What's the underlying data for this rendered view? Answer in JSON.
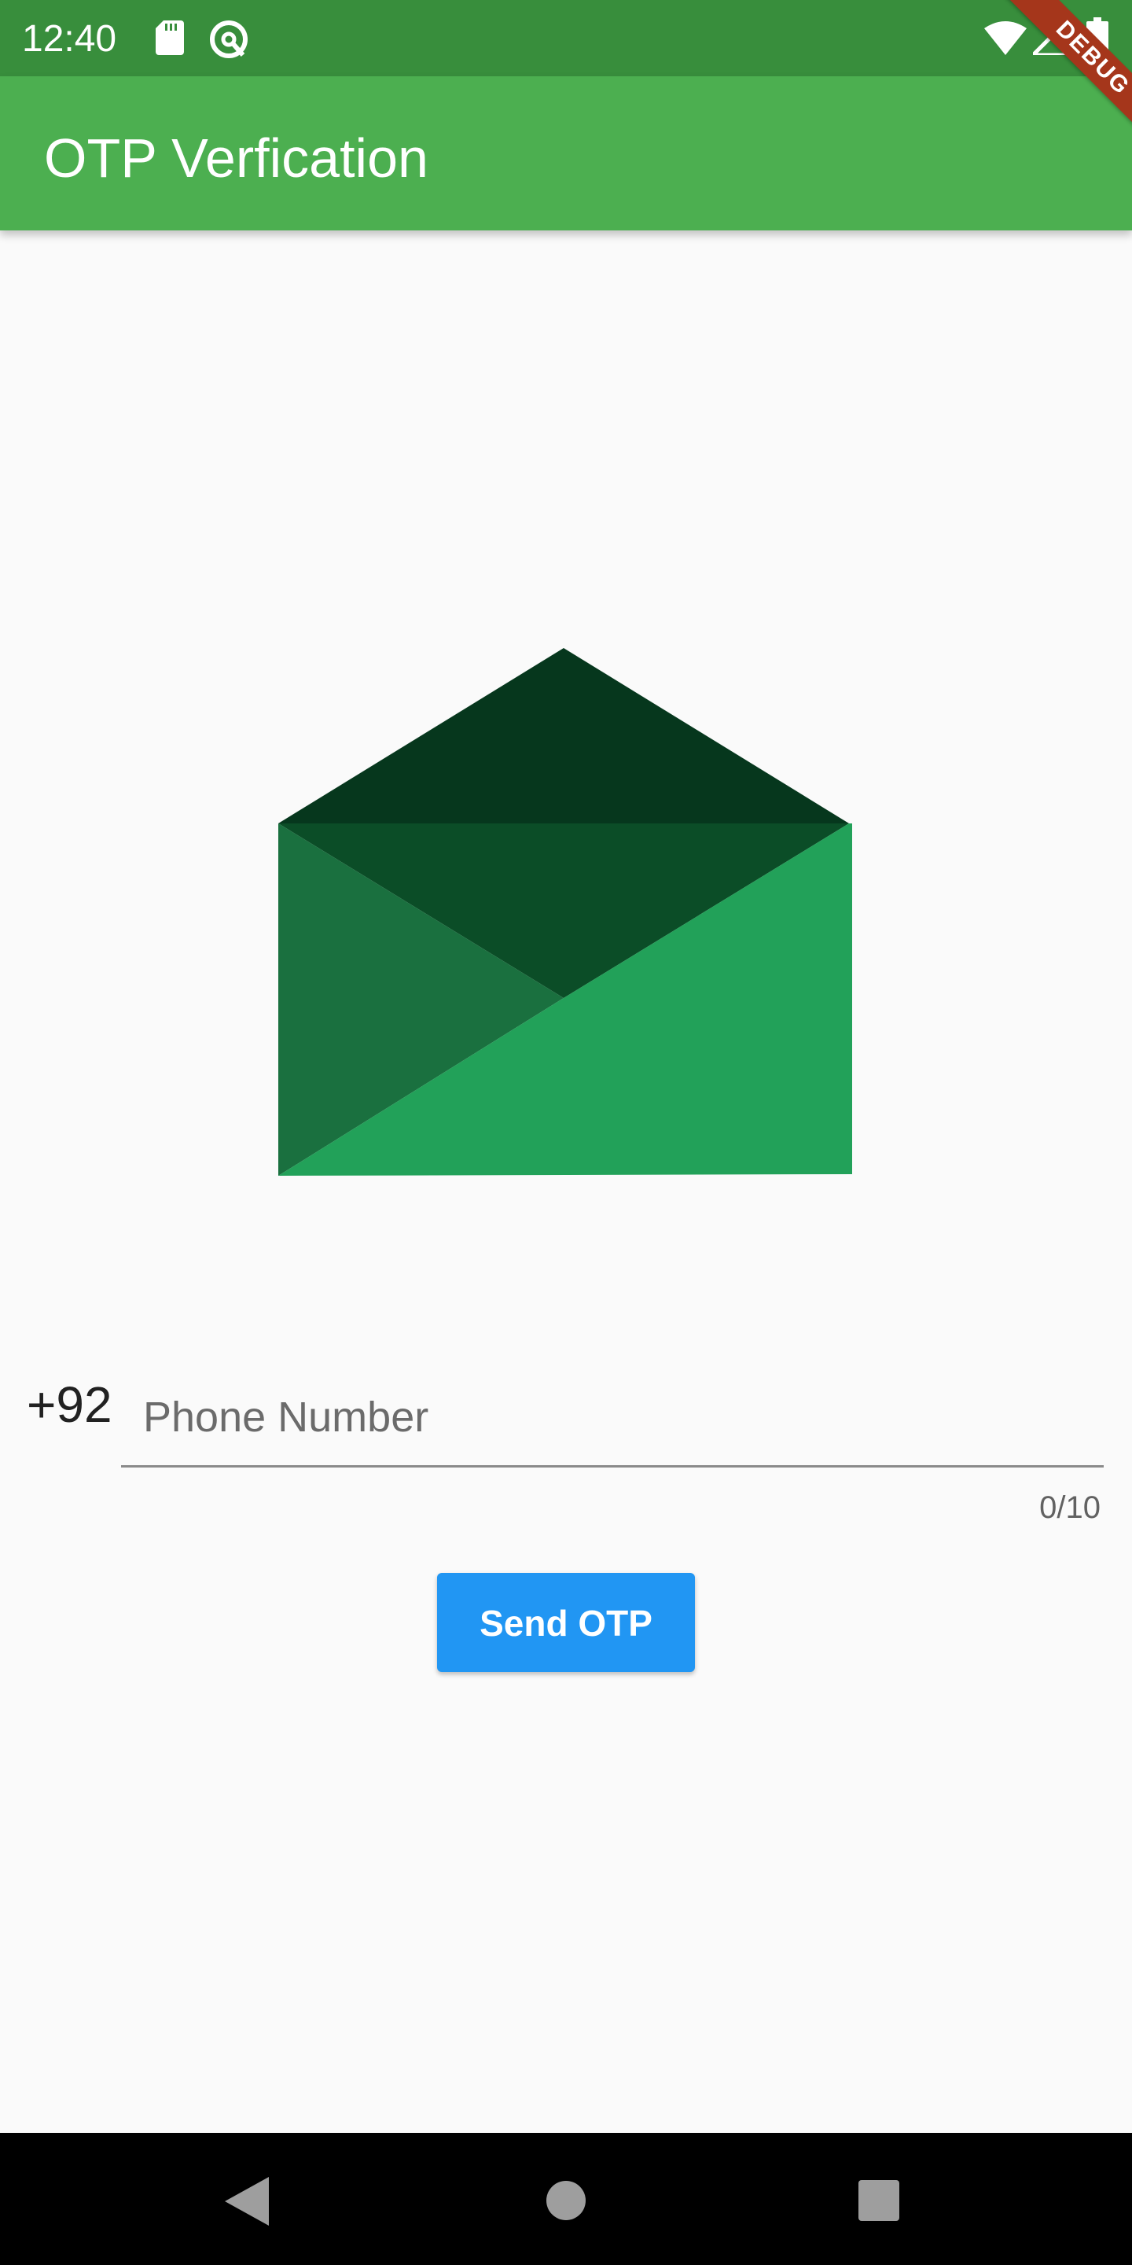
{
  "status_bar": {
    "time": "12:40",
    "icons": [
      "sd-card-icon",
      "q-icon",
      "wifi-icon",
      "cell-signal-icon",
      "battery-icon"
    ],
    "background_color": "#388E3C"
  },
  "debug_banner": {
    "label": "DEBUG",
    "color": "#A5361B"
  },
  "app_bar": {
    "title": "OTP Verfication",
    "color": "#4CAF50"
  },
  "illustration": {
    "icon": "envelope-icon",
    "colors": [
      "#06371D",
      "#0B4D27",
      "#1A703F",
      "#22A159"
    ]
  },
  "phone": {
    "country_code": "+92",
    "placeholder": "Phone Number",
    "value": "",
    "counter": "0/10"
  },
  "actions": {
    "send_label": "Send OTP",
    "send_color": "#2196F3"
  },
  "nav_bar": {
    "icons": [
      "back-icon",
      "home-icon",
      "recents-icon"
    ]
  }
}
